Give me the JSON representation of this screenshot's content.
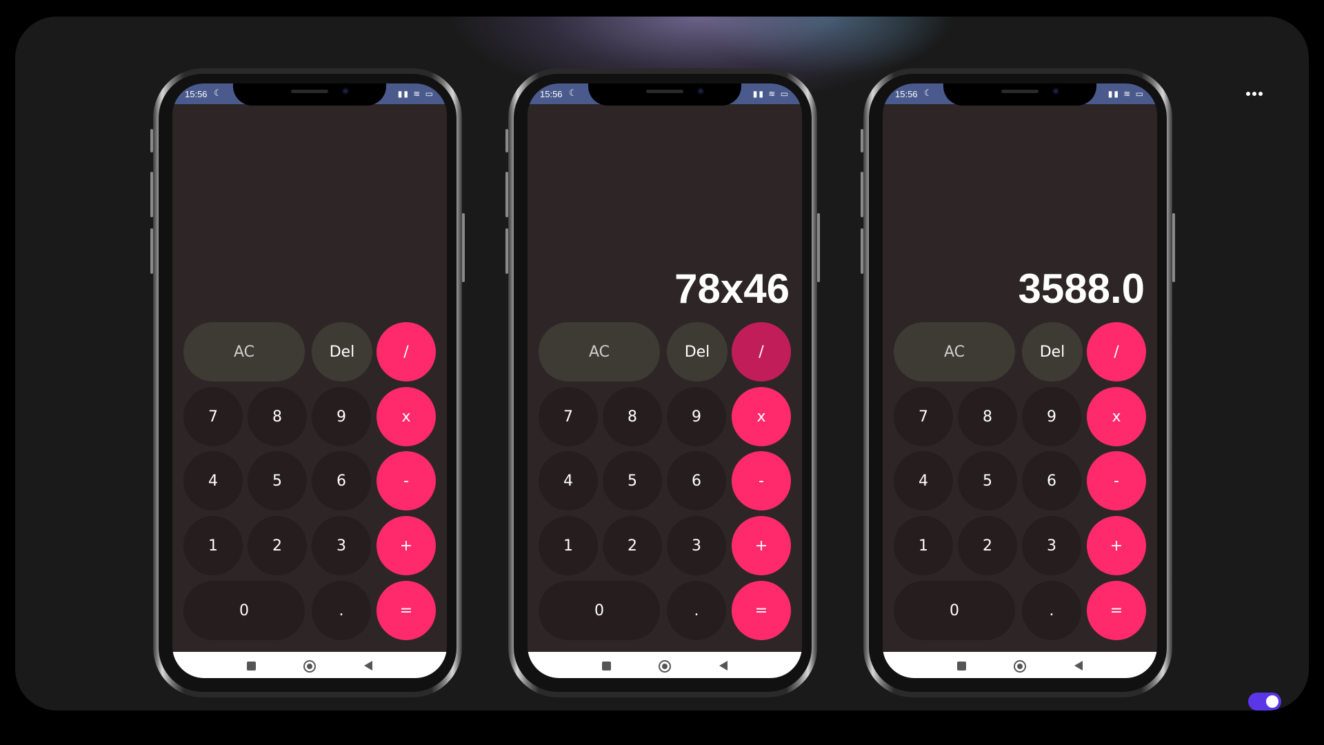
{
  "status": {
    "time": "15:56",
    "moon": "☾",
    "icons": "▮▮ ≋ ▭"
  },
  "phones": [
    {
      "display": ""
    },
    {
      "display": "78x46"
    },
    {
      "display": "3588.0"
    }
  ],
  "keys": {
    "ac": "AC",
    "del": "Del",
    "divide": "/",
    "multiply": "x",
    "minus": "-",
    "plus": "+",
    "equals": "=",
    "n7": "7",
    "n8": "8",
    "n9": "9",
    "n4": "4",
    "n5": "5",
    "n6": "6",
    "n1": "1",
    "n2": "2",
    "n3": "3",
    "n0": "0",
    "dot": "."
  },
  "colors": {
    "operator": "#ff2a6c",
    "operator_pressed": "#c11d59",
    "function": "#3d3b33",
    "number": "#261e1e",
    "screen": "#2e2626",
    "toggle": "#5b36e8"
  },
  "icons": {
    "more": "more-horizontal-icon",
    "toggle": "theme-toggle"
  }
}
